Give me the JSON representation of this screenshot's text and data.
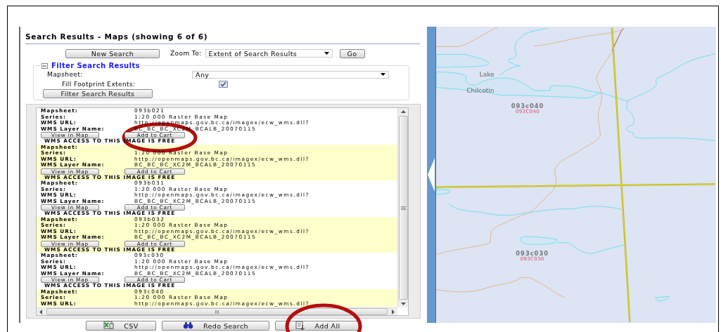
{
  "panel": {
    "title": "Search Results - Maps (showing 6 of 6)",
    "new_search": "New Search",
    "zoom_label": "Zoom To:",
    "zoom_value": "Extent of Search Results",
    "go": "Go"
  },
  "filter": {
    "title": "Filter Search Results",
    "expanded": true,
    "mapsheet_label": "Mapsheet:",
    "mapsheet_value": "Any",
    "fill_label": "Fill Footprint Extents:",
    "fill_checked": true,
    "button": "Filter Search Results"
  },
  "results": [
    {
      "shaded": false,
      "fields": [
        {
          "label": "Mapsheet:",
          "value": "093b021"
        },
        {
          "label": "Series:",
          "value": "1:20 000 Raster Base Map"
        },
        {
          "label": "WMS URL:",
          "value": "http://openmaps.gov.bc.ca/imagex/ecw_wms.dll?"
        },
        {
          "label": "WMS Layer Name:",
          "value": "BC_BC_BC_XC2M_BCALB_20070115"
        }
      ],
      "buttons": [
        "View in Map",
        "Add to Cart"
      ],
      "notice": "WMS ACCESS TO THIS IMAGE IS FREE"
    },
    {
      "shaded": true,
      "fields": [
        {
          "label": "Mapsheet:"
        },
        {
          "label": "Series:",
          "value": "1:20 000 Raster Base Map"
        },
        {
          "label": "WMS URL:",
          "value": "http://openmaps.gov.bc.ca/imagex/ecw_wms.dll?"
        },
        {
          "label": "WMS Layer Name:",
          "value": "BC_BC_BC_XC2M_BCALB_20070115"
        }
      ],
      "buttons": [
        "View in Map",
        "Add to Cart"
      ],
      "notice": "WMS ACCESS TO THIS IMAGE IS FREE"
    },
    {
      "shaded": false,
      "fields": [
        {
          "label": "Mapsheet:",
          "value": "093b031"
        },
        {
          "label": "Series:",
          "value": "1:20 000 Raster Base Map"
        },
        {
          "label": "WMS URL:",
          "value": "http://openmaps.gov.bc.ca/imagex/ecw_wms.dll?"
        },
        {
          "label": "WMS Layer Name:",
          "value": "BC_BC_BC_XC2M_BCALB_20070115"
        }
      ],
      "buttons": [
        "View in Map",
        "Add to Cart"
      ],
      "notice": "WMS ACCESS TO THIS IMAGE IS FREE"
    },
    {
      "shaded": true,
      "fields": [
        {
          "label": "Mapsheet:",
          "value": "093b032"
        },
        {
          "label": "Series:",
          "value": "1:20 000 Raster Base Map"
        },
        {
          "label": "WMS URL:",
          "value": "http://openmaps.gov.bc.ca/imagex/ecw_wms.dll?"
        },
        {
          "label": "WMS Layer Name:",
          "value": "BC_BC_BC_XC2M_BCALB_20070115"
        }
      ],
      "buttons": [
        "View in Map",
        "Add to Cart"
      ],
      "notice": "WMS ACCESS TO THIS IMAGE IS FREE"
    },
    {
      "shaded": false,
      "fields": [
        {
          "label": "Mapsheet:",
          "value": "093c030"
        },
        {
          "label": "Series:",
          "value": "1:20 000 Raster Base Map"
        },
        {
          "label": "WMS URL:",
          "value": "http://openmaps.gov.bc.ca/imagex/ecw_wms.dll?"
        },
        {
          "label": "WMS Layer Name:",
          "value": "BC_BC_BC_XC2M_BCALB_20070115"
        }
      ],
      "buttons": [
        "View in Map",
        "Add to Cart"
      ],
      "notice": "WMS ACCESS TO THIS IMAGE IS FREE"
    },
    {
      "shaded": true,
      "fields": [
        {
          "label": "Mapsheet:",
          "value": "093c040"
        },
        {
          "label": "Series:",
          "value": "1:20 000 Raster Base Map"
        },
        {
          "label": "WMS URL:",
          "value": "http://openmaps.gov.bc.ca/imagex/ecw_wms.dll?"
        }
      ]
    }
  ],
  "actions": [
    {
      "kind": "csv",
      "label": "CSV"
    },
    {
      "kind": "redo",
      "label": "Redo Search"
    },
    {
      "kind": "add",
      "label": "Add All"
    }
  ],
  "map": {
    "labels": [
      {
        "kind": "place",
        "text": "Lake"
      },
      {
        "kind": "place",
        "text": "Chilcotin"
      },
      {
        "kind": "sheet",
        "text": "093c040"
      },
      {
        "kind": "code",
        "text": "093C040"
      },
      {
        "kind": "sheet",
        "text": "093c030"
      },
      {
        "kind": "code",
        "text": "093C030"
      }
    ]
  }
}
